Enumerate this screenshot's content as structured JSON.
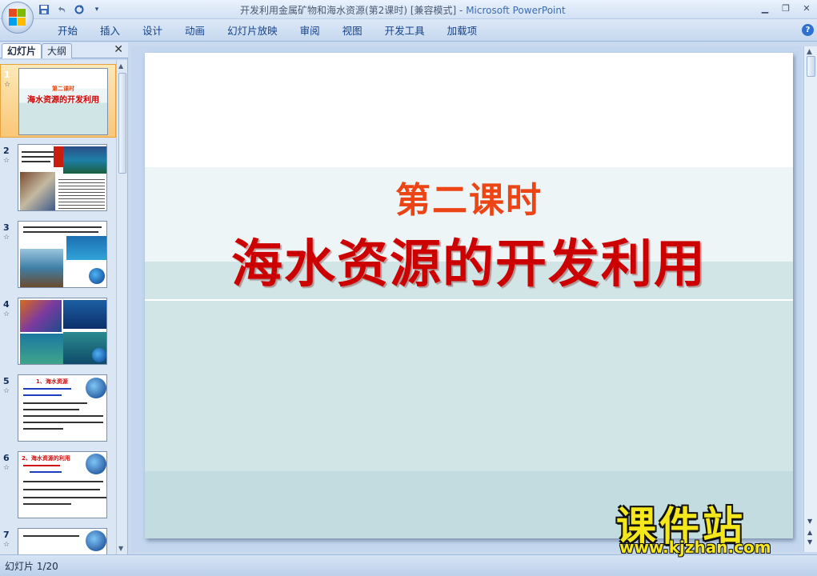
{
  "window": {
    "title": "开发利用金属矿物和海水资源(第2课时) [兼容模式]",
    "app_name": "Microsoft PowerPoint",
    "title_separator": "-"
  },
  "quick_access": {
    "icons": [
      "save-icon",
      "undo-icon",
      "redo-icon",
      "customize-icon"
    ]
  },
  "ribbon": {
    "tabs": [
      "开始",
      "插入",
      "设计",
      "动画",
      "幻灯片放映",
      "审阅",
      "视图",
      "开发工具",
      "加载项"
    ]
  },
  "left_pane": {
    "tab_slides": "幻灯片",
    "tab_outline": "大纲",
    "thumbnails": [
      {
        "num": "1",
        "line1": "第二课时",
        "line2": "海水资源的开发利用"
      },
      {
        "num": "2"
      },
      {
        "num": "3"
      },
      {
        "num": "4"
      },
      {
        "num": "5",
        "heading": "1、海水资源"
      },
      {
        "num": "6",
        "heading": "2、海水资源的利用"
      },
      {
        "num": "7"
      }
    ],
    "star": "☆"
  },
  "slide": {
    "subtitle": "第二课时",
    "title": "海水资源的开发利用"
  },
  "status": {
    "text": "幻灯片 1/20"
  },
  "watermark": {
    "title": "课件站",
    "url": "www.kjzhan.com"
  },
  "colors": {
    "subtitle": "#ec4415",
    "title": "#cc0000",
    "band_light": "#eef5f6",
    "band_mid": "#d1e5e6",
    "watermark": "#f4e81c"
  }
}
